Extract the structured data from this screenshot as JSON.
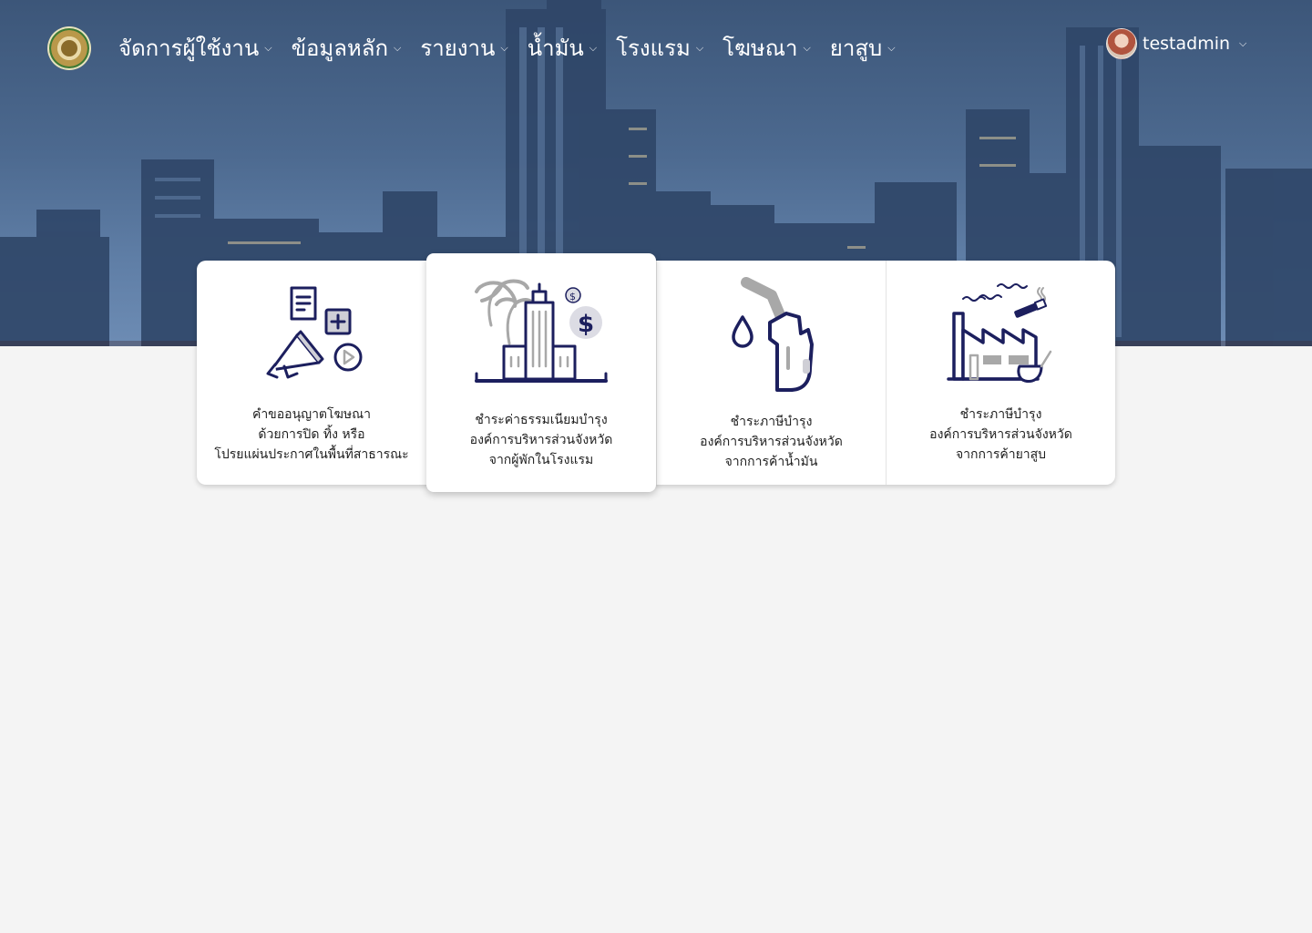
{
  "nav": {
    "menu": [
      {
        "label": "จัดการผู้ใช้งาน"
      },
      {
        "label": "ข้อมูลหลัก"
      },
      {
        "label": "รายงาน"
      },
      {
        "label": "น้ำมัน"
      },
      {
        "label": "โรงแรม"
      },
      {
        "label": "โฆษณา"
      },
      {
        "label": "ยาสูบ"
      }
    ],
    "user": {
      "name": "testadmin"
    }
  },
  "cards": [
    {
      "lines": [
        "คำขออนุญาตโฆษณา",
        "ด้วยการปิด ทิ้ง หรือ",
        "โปรยแผ่นประกาศในพื้นที่สาธารณะ"
      ],
      "icon": "advertising-icon"
    },
    {
      "lines": [
        "ชำระค่าธรรมเนียมบำรุง",
        "องค์การบริหารส่วนจังหวัด",
        "จากผู้พักในโรงแรม"
      ],
      "icon": "hotel-fee-icon"
    },
    {
      "lines": [
        "ชำระภาษีบำรุง",
        "องค์การบริหารส่วนจังหวัด",
        "จากการค้าน้ำมัน"
      ],
      "icon": "fuel-nozzle-icon"
    },
    {
      "lines": [
        "ชำระภาษีบำรุง",
        "องค์การบริหารส่วนจังหวัด",
        "จากการค้ายาสูบ"
      ],
      "icon": "tobacco-factory-icon"
    }
  ],
  "colors": {
    "icon_primary": "#1c1f5e",
    "icon_secondary": "#a8a8a8",
    "text": "#1e1e1e"
  }
}
